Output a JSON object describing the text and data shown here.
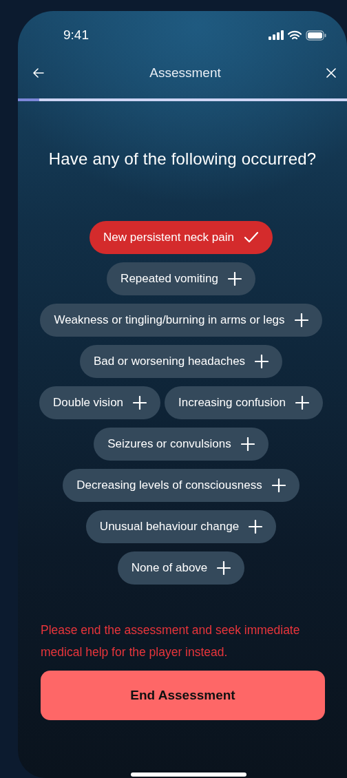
{
  "status_bar": {
    "time": "9:41"
  },
  "nav": {
    "title": "Assessment"
  },
  "progress": {
    "level": 0.065
  },
  "question": "Have any of the following occurred?",
  "option_rows": [
    [
      {
        "label": "New persistent neck pain",
        "selected": true
      }
    ],
    [
      {
        "label": "Repeated vomiting",
        "selected": false
      }
    ],
    [
      {
        "label": "Weakness or tingling/burning in arms or legs",
        "selected": false
      }
    ],
    [
      {
        "label": "Bad or worsening headaches",
        "selected": false
      }
    ],
    [
      {
        "label": "Double vision",
        "selected": false
      },
      {
        "label": "Increasing confusion",
        "selected": false
      }
    ],
    [
      {
        "label": "Seizures or convulsions",
        "selected": false
      }
    ],
    [
      {
        "label": "Decreasing levels of consciousness",
        "selected": false
      }
    ],
    [
      {
        "label": "Unusual behaviour change",
        "selected": false
      }
    ],
    [
      {
        "label": "None of above",
        "selected": false
      }
    ]
  ],
  "warning": "Please end the assessment and seek immediate medical help for the player instead.",
  "end_button": "End Assessment"
}
